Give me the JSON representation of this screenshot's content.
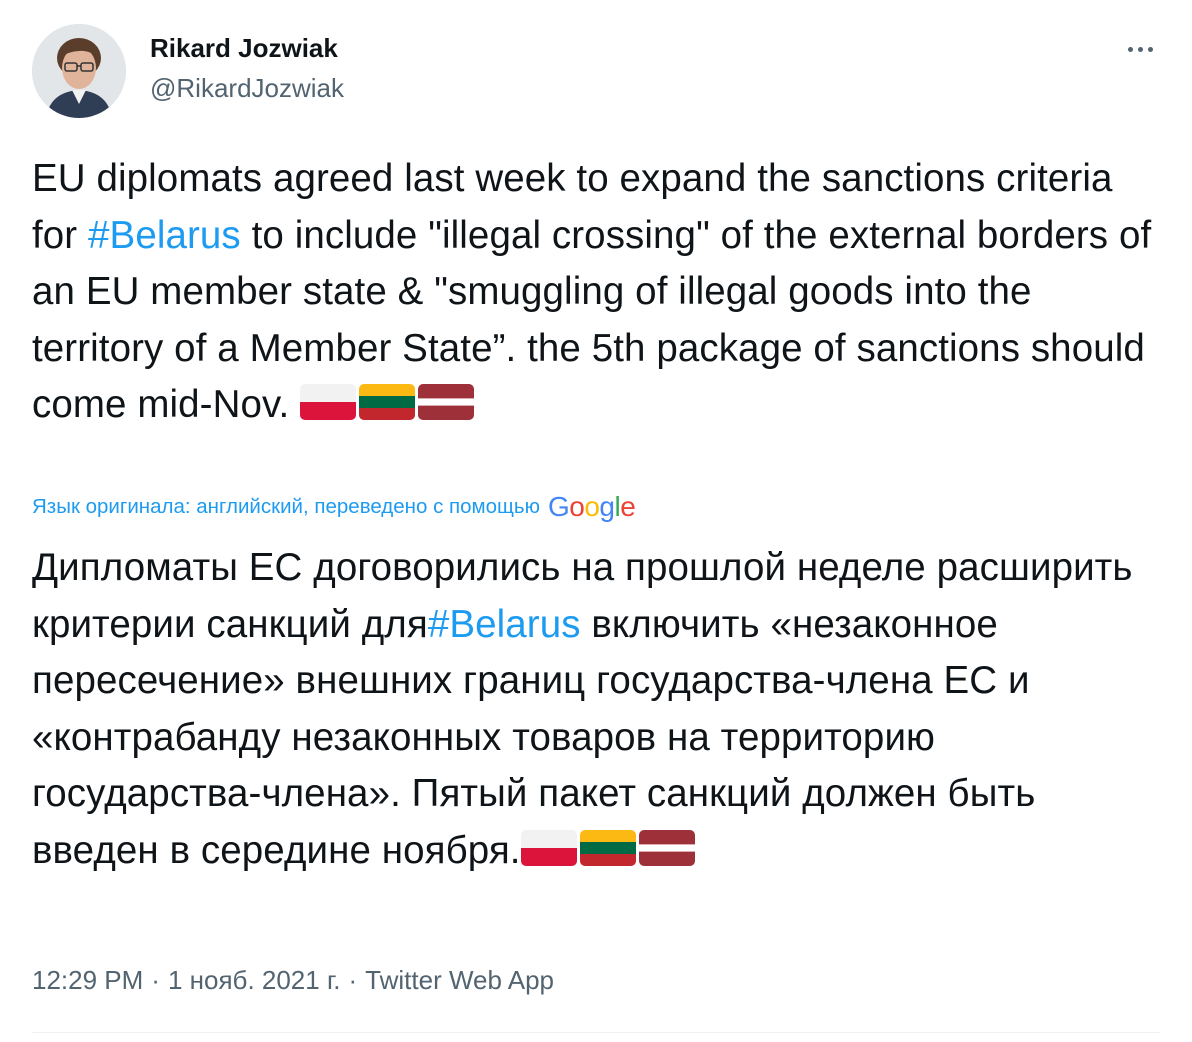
{
  "author": {
    "display_name": "Rikard Jozwiak",
    "handle": "@RikardJozwiak"
  },
  "tweet": {
    "en_part1": "EU diplomats agreed last week to expand the sanctions criteria for ",
    "en_hashtag": "#Belarus",
    "en_part2": " to include \"illegal crossing\" of the external borders of an EU member state & \"smuggling of illegal goods into the territory of a Member State”. the 5th package of sanctions should come mid-Nov. ",
    "flags": [
      "poland-flag-emoji",
      "lithuania-flag-emoji",
      "latvia-flag-emoji"
    ],
    "translation_label": "Язык оригинала: английский, переведено с помощью",
    "translation_provider": "Google",
    "ru_part1": "Дипломаты ЕС договорились на прошлой неделе расширить критерии санкций для",
    "ru_hashtag": "#Belarus",
    "ru_part2": " включить «незаконное пересечение» внешних границ государства-члена ЕС и «контрабанду незаконных товаров на территорию государства-члена». Пятый пакет санкций должен быть введен в середине ноября."
  },
  "meta": {
    "time": "12:29 PM",
    "date": "1 нояб. 2021 г.",
    "source": "Twitter Web App",
    "separator": "·"
  },
  "colors": {
    "text": "#0f1419",
    "secondary": "#536471",
    "link": "#1d9bf0",
    "divider": "#eff3f4"
  },
  "icons": {
    "more": "more-dots-icon"
  }
}
